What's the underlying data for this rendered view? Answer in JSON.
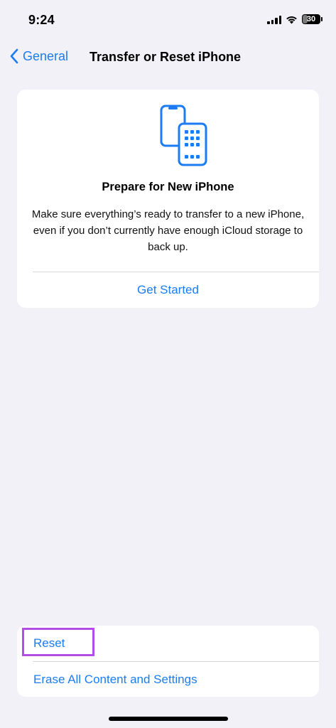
{
  "status_bar": {
    "time": "9:24",
    "battery_level": "30",
    "battery_fraction": 0.3,
    "signal_icon": "signal-bars-icon",
    "wifi_icon": "wifi-icon",
    "battery_icon": "battery-icon"
  },
  "nav": {
    "back_label": "General",
    "back_icon": "chevron-left-icon",
    "title": "Transfer or Reset iPhone"
  },
  "prepare": {
    "icon": "transfer-phones-icon",
    "title": "Prepare for New iPhone",
    "description": "Make sure everything’s ready to transfer to a new iPhone, even if you don’t currently have enough iCloud storage to back up.",
    "action_label": "Get Started"
  },
  "reset_list": {
    "items": [
      {
        "label": "Reset"
      },
      {
        "label": "Erase All Content and Settings"
      }
    ]
  },
  "colors": {
    "accent": "#1b7cf4",
    "background": "#f2f1f7",
    "highlight": "#b24ee6"
  }
}
